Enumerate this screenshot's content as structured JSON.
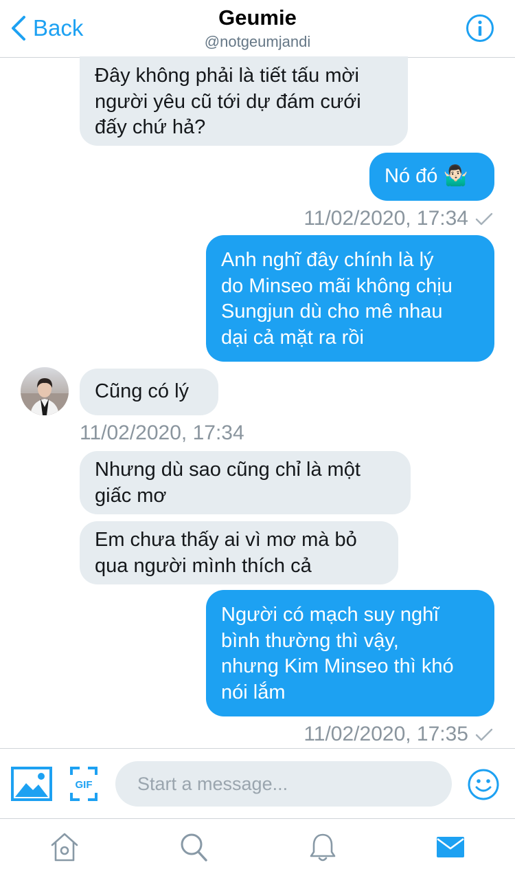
{
  "header": {
    "back_label": "Back",
    "title": "Geumie",
    "handle": "@notgeumjandi"
  },
  "messages": [
    {
      "side": "received",
      "lines": [
        "Đây không phải là tiết tấu mời",
        "người yêu cũ tới dự đám cưới",
        "đấy chứ hả?"
      ]
    },
    {
      "side": "sent",
      "lines": [
        "Nó đó 🤷🏻‍♂️"
      ]
    },
    {
      "side": "sent",
      "lines": [
        "Anh nghĩ đây chính là lý",
        "do Minseo mãi không chịu",
        "Sungjun dù cho mê nhau",
        "dại cả mặt ra rồi"
      ]
    },
    {
      "side": "received",
      "lines": [
        "Cũng có lý"
      ]
    },
    {
      "side": "received",
      "lines": [
        "Nhưng dù sao cũng chỉ là một",
        "giấc mơ"
      ]
    },
    {
      "side": "received",
      "lines": [
        "Em chưa thấy ai vì mơ mà bỏ",
        "qua người mình thích cả"
      ]
    },
    {
      "side": "sent",
      "lines": [
        "Người có mạch suy nghĩ",
        "bình thường thì vậy,",
        "nhưng Kim Minseo thì khó",
        "nói lắm"
      ]
    }
  ],
  "timestamps": [
    "11/02/2020, 17:34",
    "11/02/2020, 17:34",
    "11/02/2020, 17:35"
  ],
  "composer": {
    "placeholder": "Start a message...",
    "media_icon": "image-icon",
    "gif_label": "GIF",
    "emoji_icon": "smiley-icon"
  },
  "tabs": [
    {
      "name": "home",
      "icon": "home-icon",
      "active": false
    },
    {
      "name": "search",
      "icon": "search-icon",
      "active": false
    },
    {
      "name": "notifications",
      "icon": "bell-icon",
      "active": false
    },
    {
      "name": "messages",
      "icon": "envelope-icon",
      "active": true
    }
  ],
  "colors": {
    "accent": "#1da1f2",
    "received_bubble": "#e6ecf0",
    "muted_text": "#8a959e",
    "inactive_icon": "#8899a6"
  }
}
